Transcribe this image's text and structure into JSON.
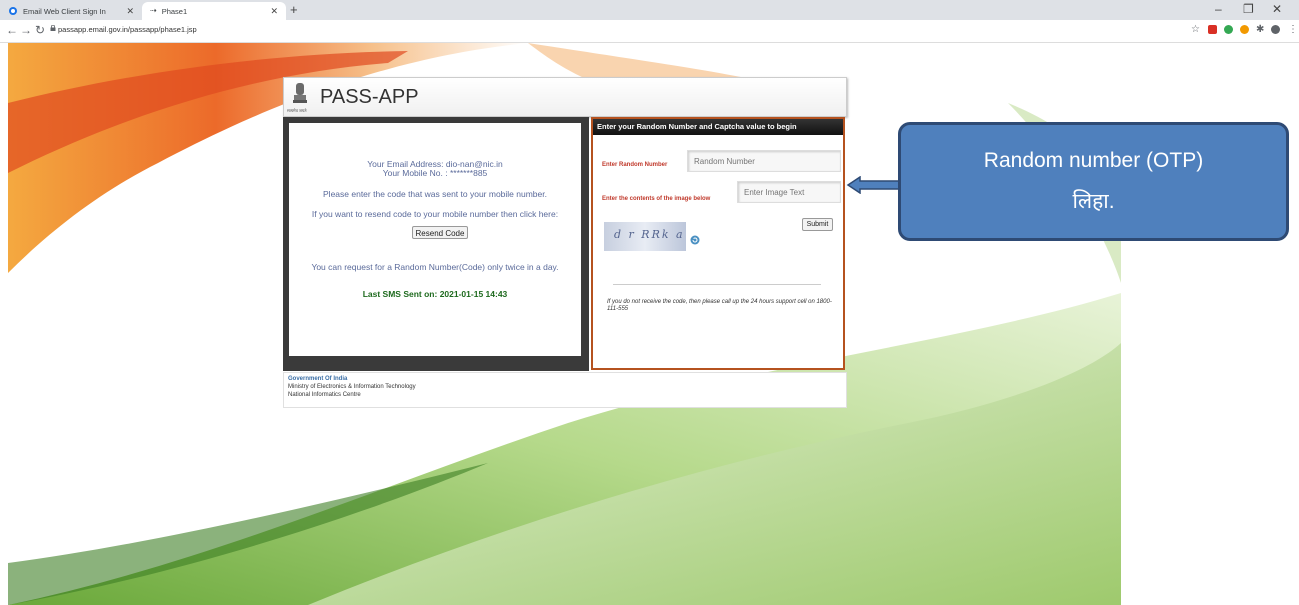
{
  "browser": {
    "tabs": [
      {
        "title": "Email Web Client Sign In"
      },
      {
        "title": "Phase1"
      }
    ],
    "url": "passapp.email.gov.in/passapp/phase1.jsp"
  },
  "header": {
    "app_title": "PASS-APP",
    "emblem_caption": "सत्यमेव जयते"
  },
  "left_panel": {
    "email_line": "Your Email Address: dio-nan@nic.in",
    "mobile_line": "Your Mobile No. : *******885",
    "enter_code_text": "Please enter the code that was sent to your mobile number.",
    "resend_prompt": "If you want to resend code to your mobile number then click here:",
    "resend_button": "Resend Code",
    "limit_text": "You can request for a Random Number(Code) only twice in a day.",
    "last_sms": "Last SMS Sent on: 2021-01-15 14:43"
  },
  "right_panel": {
    "heading": "Enter your Random Number and Captcha value to begin",
    "random_label": "Enter Random Number",
    "random_placeholder": "Random Number",
    "image_label": "Enter the contents of the image below",
    "image_placeholder": "Enter Image Text",
    "captcha_text": "d r RRk a",
    "submit_button": "Submit",
    "support_note": "If you do not receive the code, then please call up the 24 hours support cell on 1800-111-555"
  },
  "footer": {
    "org1": "Government Of India",
    "org2": "Ministry of Electronics & Information Technology",
    "org3": "National Informatics Centre"
  },
  "callout": {
    "line1": "Random number (OTP)",
    "line2": "लिहा."
  },
  "colors": {
    "callout_fill": "#4f80bd",
    "panel_border": "#b5521f",
    "label_red": "#c0392b",
    "last_sms_green": "#1e6a1e"
  }
}
